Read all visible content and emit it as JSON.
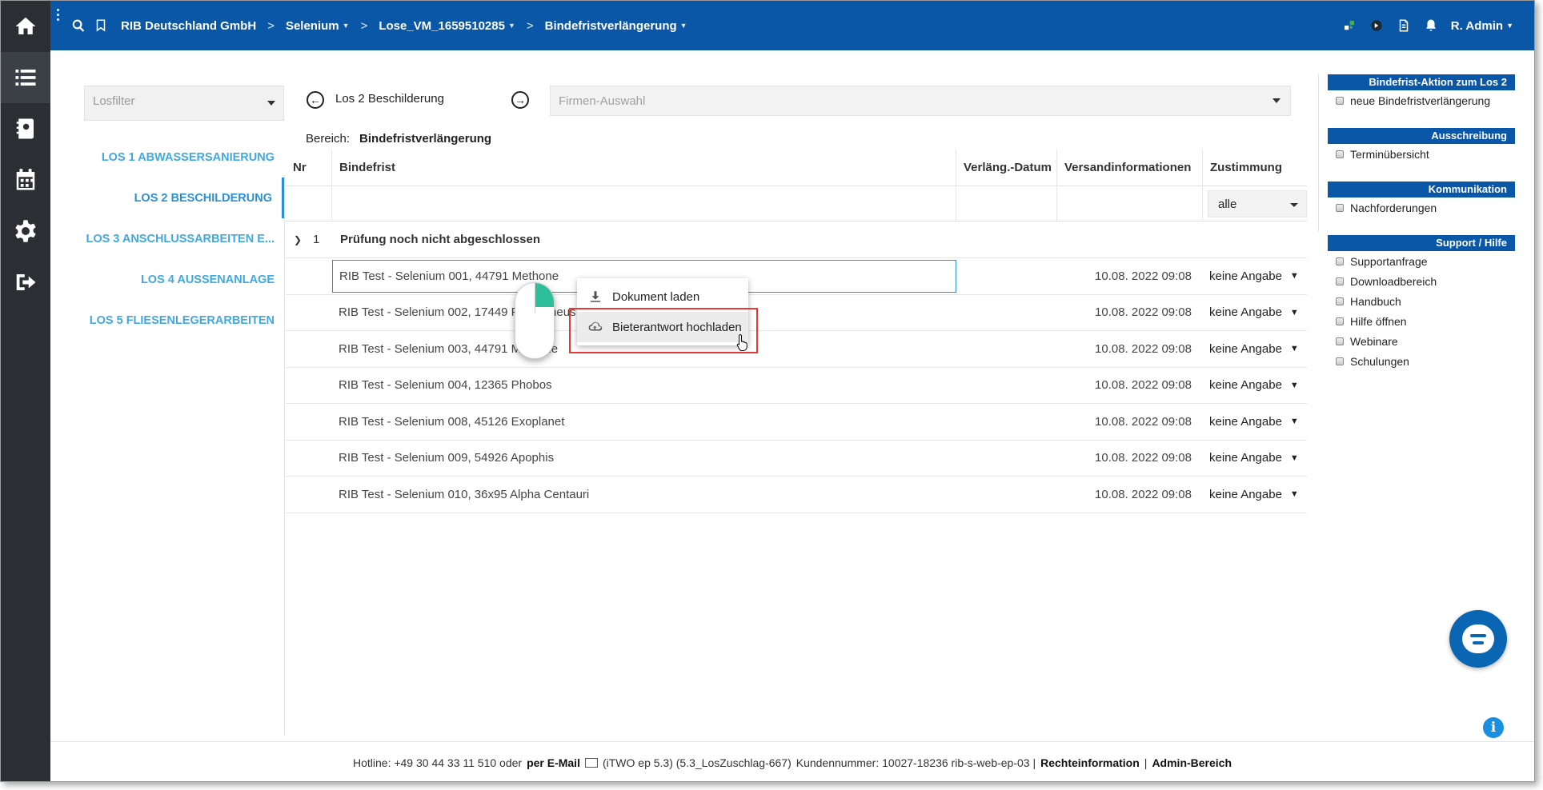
{
  "topbar": {
    "company": "RIB Deutschland GmbH",
    "crumbs": [
      "Selenium",
      "Lose_VM_1659510285",
      "Bindefristverlängerung"
    ],
    "user": "R. Admin"
  },
  "losfilter": {
    "placeholder": "Losfilter"
  },
  "lots": [
    "LOS 1 ABWASSERSANIERUNG",
    "LOS 2 BESCHILDERUNG",
    "LOS 3 ANSCHLUSSARBEITEN E...",
    "LOS 4 AUSSENANLAGE",
    "LOS 5 FLIESENLEGERARBEITEN"
  ],
  "header": {
    "current_lot": "Los 2 Beschilderung",
    "firmen_placeholder": "Firmen-Auswahl",
    "bereich_label": "Bereich:",
    "bereich_value": "Bindefristverlängerung"
  },
  "table": {
    "columns": [
      "Nr",
      "Bindefrist",
      "Verläng.-Datum",
      "Versandinformationen",
      "Zustimmung"
    ],
    "filter_value": "alle",
    "group": {
      "nr": "1",
      "label": "Prüfung noch nicht abgeschlossen"
    },
    "rows": [
      {
        "name": "RIB Test - Selenium 001, 44791 Methone",
        "date": "10.08. 2022 09:08",
        "zustimmung": "keine Angabe"
      },
      {
        "name": "RIB Test - Selenium 002, 17449 Prometheus",
        "date": "10.08. 2022 09:08",
        "zustimmung": "keine Angabe"
      },
      {
        "name": "RIB Test - Selenium 003, 44791 Methone",
        "date": "10.08. 2022 09:08",
        "zustimmung": "keine Angabe"
      },
      {
        "name": "RIB Test - Selenium 004, 12365 Phobos",
        "date": "10.08. 2022 09:08",
        "zustimmung": "keine Angabe"
      },
      {
        "name": "RIB Test - Selenium 008, 45126 Exoplanet",
        "date": "10.08. 2022 09:08",
        "zustimmung": "keine Angabe"
      },
      {
        "name": "RIB Test - Selenium 009, 54926 Apophis",
        "date": "10.08. 2022 09:08",
        "zustimmung": "keine Angabe"
      },
      {
        "name": "RIB Test - Selenium 010, 36x95 Alpha Centauri",
        "date": "10.08. 2022 09:08",
        "zustimmung": "keine Angabe"
      }
    ]
  },
  "context_menu": {
    "items": [
      "Dokument laden",
      "Bieterantwort hochladen"
    ]
  },
  "sidebar": {
    "blocks": [
      {
        "title": "Bindefrist-Aktion zum Los 2",
        "links": [
          "neue Bindefristverlängerung"
        ]
      },
      {
        "title": "Ausschreibung",
        "links": [
          "Terminübersicht"
        ]
      },
      {
        "title": "Kommunikation",
        "links": [
          "Nachforderungen"
        ]
      },
      {
        "title": "Support / Hilfe",
        "links": [
          "Supportanfrage",
          "Downloadbereich",
          "Handbuch",
          "Hilfe öffnen",
          "Webinare",
          "Schulungen"
        ]
      }
    ]
  },
  "footer": {
    "hotline": "Hotline: +49 30 44 33 11 510 oder",
    "email": "per E-Mail",
    "version": "(iTWO ep 5.3) (5.3_LosZuschlag-667)",
    "kunde": "Kundennummer: 10027-18236 rib-s-web-ep-03 |",
    "recht": "Rechteinformation",
    "pipe": "|",
    "admin": "Admin-Bereich"
  },
  "colors": {
    "brand": "#0a57a7",
    "accent": "#3fa9e0",
    "highlight": "#e53935"
  }
}
